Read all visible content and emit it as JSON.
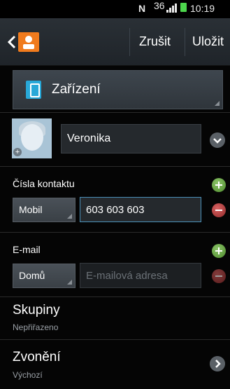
{
  "status_bar": {
    "nfc": "N",
    "network": "36",
    "time": "10:19"
  },
  "action_bar": {
    "cancel_label": "Zrušit",
    "save_label": "Uložit"
  },
  "storage": {
    "label": "Zařízení"
  },
  "name": {
    "value": "Veronika"
  },
  "phone_section": {
    "label": "Čísla kontaktu",
    "type": "Mobil",
    "value": "603 603 603"
  },
  "email_section": {
    "label": "E-mail",
    "type": "Domů",
    "placeholder": "E-mailová adresa"
  },
  "groups": {
    "title": "Skupiny",
    "value": "Nepřiřazeno"
  },
  "ringtone": {
    "title": "Zvonění",
    "value": "Výchozí"
  },
  "colors": {
    "accent": "#28a8d8",
    "add": "#5c9a36",
    "remove": "#a83232",
    "contact_logo": "#f07b1d"
  }
}
